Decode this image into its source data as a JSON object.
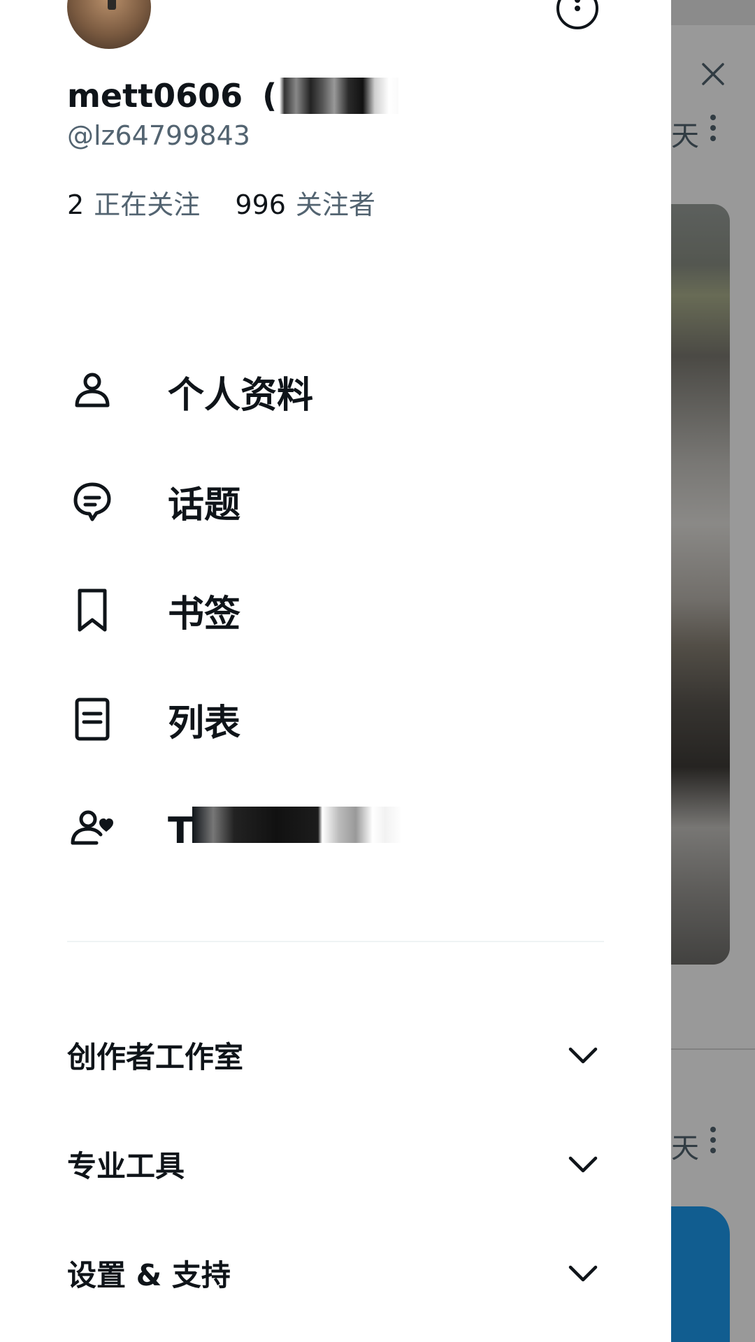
{
  "profile": {
    "display_name": "mett0606",
    "name_paren": "(",
    "handle": "@lz64799843",
    "following_count": "2",
    "following_label": "正在关注",
    "followers_count": "996",
    "followers_label": "关注者"
  },
  "menu": {
    "items": [
      {
        "label": "个人资料",
        "icon": "person-icon"
      },
      {
        "label": "话题",
        "icon": "topics-icon"
      },
      {
        "label": "书签",
        "icon": "bookmark-icon"
      },
      {
        "label": "列表",
        "icon": "list-icon"
      },
      {
        "label": "T",
        "icon": "person-heart-icon"
      }
    ]
  },
  "sections": [
    {
      "label": "创作者工作室",
      "icon": "chevron-down-icon"
    },
    {
      "label": "专业工具",
      "icon": "chevron-down-icon"
    },
    {
      "label": "设置 & 支持",
      "icon": "chevron-down-icon"
    }
  ],
  "background_feed": {
    "label_a": "天",
    "label_b": "天"
  },
  "colors": {
    "text_primary": "#0f1419",
    "text_secondary": "#536471",
    "accent": "#1d9bf0",
    "divider": "#eff3f4"
  }
}
